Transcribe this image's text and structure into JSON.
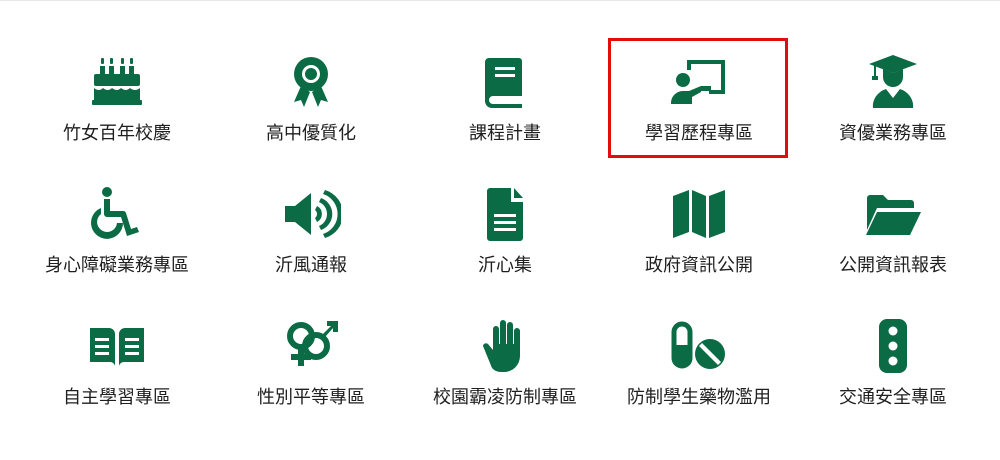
{
  "colors": {
    "icon": "#0b6b45",
    "highlight_border": "#e00d0d",
    "text": "#1f1f1f"
  },
  "tiles": [
    {
      "label": "竹女百年校慶",
      "icon": "birthday-cake-icon"
    },
    {
      "label": "高中優質化",
      "icon": "award-ribbon-icon"
    },
    {
      "label": "課程計畫",
      "icon": "book-icon"
    },
    {
      "label": "學習歷程專區",
      "icon": "teacher-board-icon",
      "highlighted": true
    },
    {
      "label": "資優業務專區",
      "icon": "graduate-icon"
    },
    {
      "label": "身心障礙業務專區",
      "icon": "wheelchair-icon"
    },
    {
      "label": "沂風通報",
      "icon": "volume-speaker-icon"
    },
    {
      "label": "沂心集",
      "icon": "document-icon"
    },
    {
      "label": "政府資訊公開",
      "icon": "map-icon"
    },
    {
      "label": "公開資訊報表",
      "icon": "open-folder-icon"
    },
    {
      "label": "自主學習專區",
      "icon": "open-book-icon"
    },
    {
      "label": "性別平等專區",
      "icon": "gender-venus-mars-icon"
    },
    {
      "label": "校園霸凌防制專區",
      "icon": "hand-stop-icon"
    },
    {
      "label": "防制學生藥物濫用",
      "icon": "pills-icon"
    },
    {
      "label": "交通安全專區",
      "icon": "traffic-light-icon"
    }
  ]
}
